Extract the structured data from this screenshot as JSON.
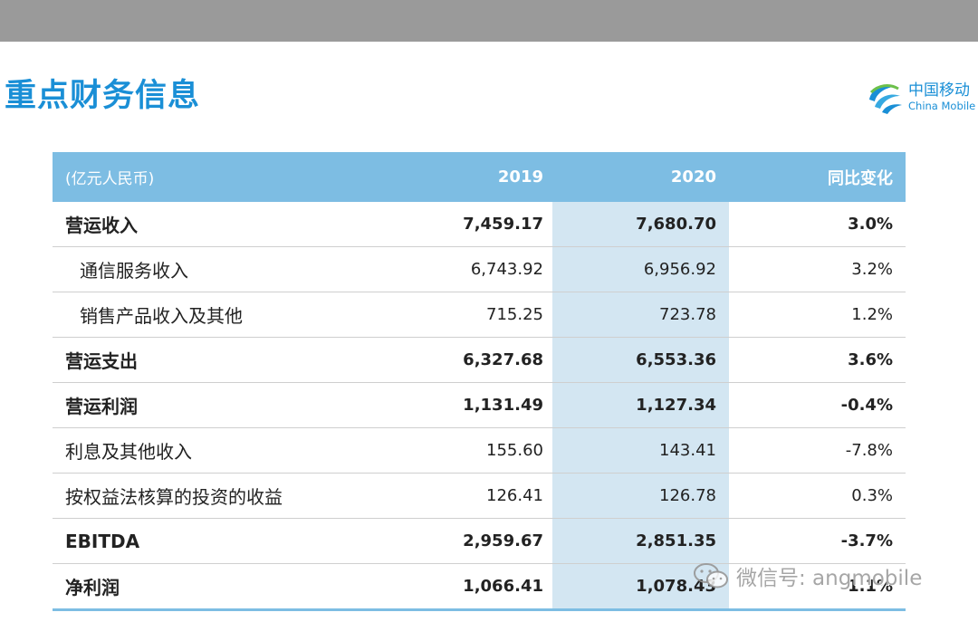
{
  "title": "重点财务信息",
  "logo": {
    "cn": "中国移动",
    "en": "China Mobile",
    "icon": "china-mobile-logo"
  },
  "table": {
    "header": {
      "label": "(亿元人民币)",
      "col_2019": "2019",
      "col_2020": "2020",
      "col_change": "同比变化"
    },
    "rows": [
      {
        "label": "营运收入",
        "v2019": "7,459.17",
        "v2020": "7,680.70",
        "change": "3.0%"
      },
      {
        "label": "通信服务收入",
        "v2019": "6,743.92",
        "v2020": "6,956.92",
        "change": "3.2%"
      },
      {
        "label": "销售产品收入及其他",
        "v2019": "715.25",
        "v2020": "723.78",
        "change": "1.2%"
      },
      {
        "label": "营运支出",
        "v2019": "6,327.68",
        "v2020": "6,553.36",
        "change": "3.6%"
      },
      {
        "label": "营运利润",
        "v2019": "1,131.49",
        "v2020": "1,127.34",
        "change": "-0.4%"
      },
      {
        "label": "利息及其他收入",
        "v2019": "155.60",
        "v2020": "143.41",
        "change": "-7.8%"
      },
      {
        "label": "按权益法核算的投资的收益",
        "v2019": "126.41",
        "v2020": "126.78",
        "change": "0.3%"
      },
      {
        "label": "EBITDA",
        "v2019": "2,959.67",
        "v2020": "2,851.35",
        "change": "-3.7%"
      },
      {
        "label": "净利润",
        "v2019": "1,066.41",
        "v2020": "1,078.43",
        "change": "1.1%"
      }
    ]
  },
  "watermark": {
    "text": "微信号: angmobile",
    "icon": "wechat-icon"
  },
  "colors": {
    "accent": "#1a8fd6",
    "header_bg": "#7dbde3",
    "highlight_col": "#d3e6f2",
    "top_band": "#9a9a9a"
  }
}
